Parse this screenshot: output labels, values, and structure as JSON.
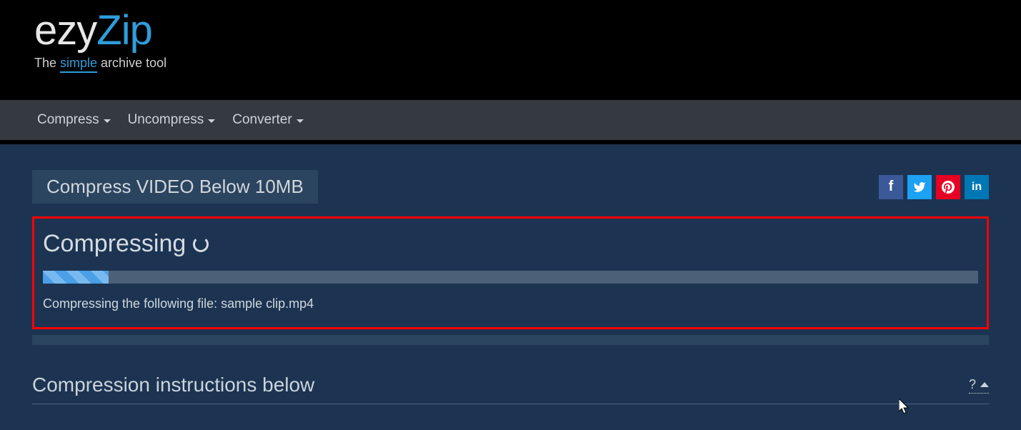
{
  "brand": {
    "part1": "ezy",
    "part2": "Zip",
    "tag_prefix": "The ",
    "tag_highlight": "simple",
    "tag_suffix": " archive tool"
  },
  "nav": {
    "items": [
      {
        "label": "Compress"
      },
      {
        "label": "Uncompress"
      },
      {
        "label": "Converter"
      }
    ]
  },
  "page": {
    "title": "Compress VIDEO Below 10MB"
  },
  "social": {
    "facebook_label": "f",
    "twitter_icon": "twitter-icon",
    "pinterest_icon": "pinterest-icon",
    "linkedin_label": "in"
  },
  "progress": {
    "heading": "Compressing",
    "percent": 7,
    "status": "Compressing the following file: sample clip.mp4"
  },
  "instructions": {
    "title": "Compression instructions below",
    "help_label": "?"
  }
}
